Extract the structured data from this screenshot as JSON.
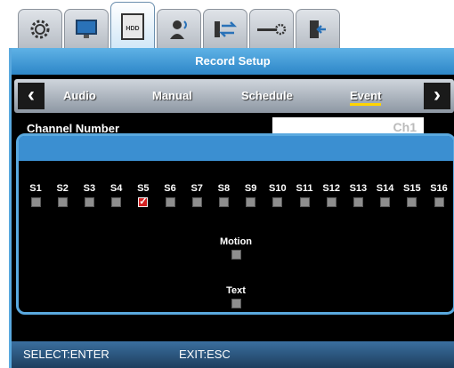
{
  "tabs": [
    {
      "icon": "gear-icon"
    },
    {
      "icon": "monitor-icon"
    },
    {
      "icon": "hdd-icon",
      "label": "HDD"
    },
    {
      "icon": "user-icon"
    },
    {
      "icon": "network-icon"
    },
    {
      "icon": "settings-slider-icon"
    },
    {
      "icon": "exit-door-icon"
    }
  ],
  "window": {
    "title": "Record Setup"
  },
  "subtabs": [
    "Audio",
    "Manual",
    "Schedule",
    "Event"
  ],
  "active_subtab": "Event",
  "channel": {
    "label": "Channel Number",
    "value": "Ch1"
  },
  "sensors": [
    {
      "label": "S1",
      "checked": false
    },
    {
      "label": "S2",
      "checked": false
    },
    {
      "label": "S3",
      "checked": false
    },
    {
      "label": "S4",
      "checked": false
    },
    {
      "label": "S5",
      "checked": true
    },
    {
      "label": "S6",
      "checked": false
    },
    {
      "label": "S7",
      "checked": false
    },
    {
      "label": "S8",
      "checked": false
    },
    {
      "label": "S9",
      "checked": false
    },
    {
      "label": "S10",
      "checked": false
    },
    {
      "label": "S11",
      "checked": false
    },
    {
      "label": "S12",
      "checked": false
    },
    {
      "label": "S13",
      "checked": false
    },
    {
      "label": "S14",
      "checked": false
    },
    {
      "label": "S15",
      "checked": false
    },
    {
      "label": "S16",
      "checked": false
    }
  ],
  "options": {
    "motion": {
      "label": "Motion",
      "checked": false
    },
    "text": {
      "label": "Text",
      "checked": false
    }
  },
  "footer": {
    "select": "SELECT:ENTER",
    "exit": "EXIT:ESC"
  },
  "colors": {
    "accent": "#3b8fd1",
    "checked": "#d22020",
    "unchecked": "#8e8e8e",
    "highlight": "#ffd400"
  }
}
